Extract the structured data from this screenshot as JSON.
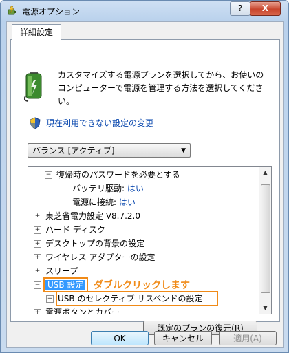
{
  "window": {
    "title": "電源オプション",
    "help_label": "?",
    "close_label": "X"
  },
  "tab": {
    "label": "詳細設定"
  },
  "description": "カスタマイズする電源プランを選択してから、お使いのコンピューターで電源を管理する方法を選択してください。",
  "link_text": "現在利用できない設定の変更",
  "plan_select": {
    "value": "バランス [アクティブ]"
  },
  "tree": {
    "items": [
      {
        "label": "復帰時のパスワードを必要とする",
        "expander": "−",
        "level": 1
      },
      {
        "label": "バッテリ駆動:",
        "value": "はい",
        "level": 2
      },
      {
        "label": "電源に接続:",
        "value": "はい",
        "level": 2
      },
      {
        "label": "東芝省電力設定 V8.7.2.0",
        "expander": "+",
        "level": 0
      },
      {
        "label": "ハード ディスク",
        "expander": "+",
        "level": 0
      },
      {
        "label": "デスクトップの背景の設定",
        "expander": "+",
        "level": 0
      },
      {
        "label": "ワイヤレス アダプターの設定",
        "expander": "+",
        "level": 0
      },
      {
        "label": "スリープ",
        "expander": "+",
        "level": 0
      },
      {
        "label": "USB 設定",
        "expander": "−",
        "level": 0,
        "selected": true
      },
      {
        "label": "USB のセレクティブ サスペンドの設定",
        "expander": "+",
        "level": 1
      },
      {
        "label": "電源ボタンとカバー",
        "expander": "+",
        "level": 0
      }
    ]
  },
  "annotation": "ダブルクリックします",
  "buttons": {
    "restore": "既定のプランの復元(R)",
    "ok": "OK",
    "cancel": "キャンセル",
    "apply": "適用(A)"
  },
  "colors": {
    "highlight": "#f08a17",
    "selection": "#3399ff",
    "link": "#0645ad"
  }
}
